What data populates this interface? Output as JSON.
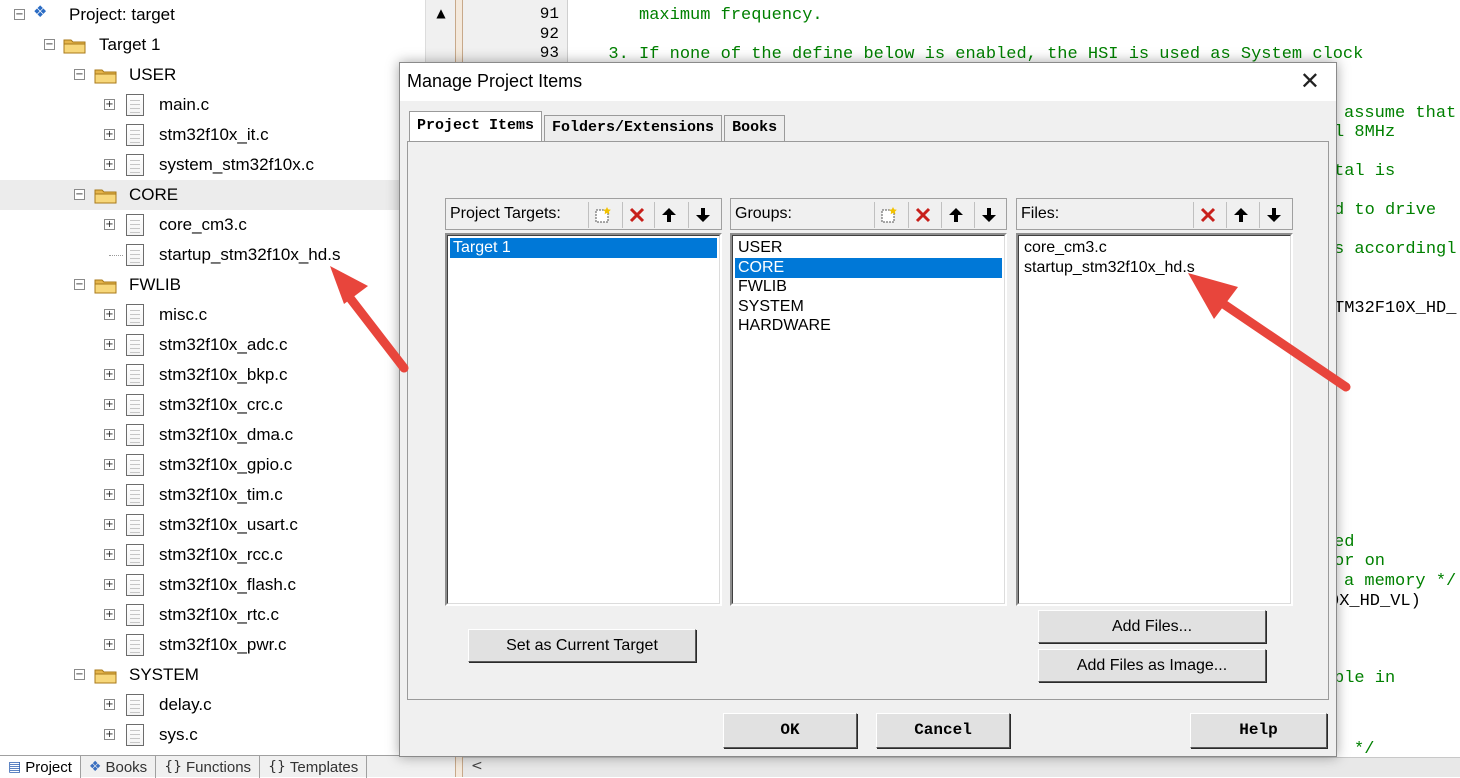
{
  "tree": {
    "project_label": "Project: target",
    "target_label": "Target 1",
    "groups": [
      {
        "name": "USER",
        "files": [
          "main.c",
          "stm32f10x_it.c",
          "system_stm32f10x.c"
        ]
      },
      {
        "name": "CORE",
        "files": [
          "core_cm3.c",
          "startup_stm32f10x_hd.s"
        ]
      },
      {
        "name": "FWLIB",
        "files": [
          "misc.c",
          "stm32f10x_adc.c",
          "stm32f10x_bkp.c",
          "stm32f10x_crc.c",
          "stm32f10x_dma.c",
          "stm32f10x_gpio.c",
          "stm32f10x_tim.c",
          "stm32f10x_usart.c",
          "stm32f10x_rcc.c",
          "stm32f10x_flash.c",
          "stm32f10x_rtc.c",
          "stm32f10x_pwr.c"
        ]
      },
      {
        "name": "SYSTEM",
        "files": [
          "delay.c",
          "sys.c"
        ]
      }
    ],
    "selected_group": "CORE"
  },
  "bottom_tabs": [
    {
      "label": "Project",
      "icon": "project-icon"
    },
    {
      "label": "Books",
      "icon": "books-icon"
    },
    {
      "label": "Functions",
      "icon": "functions-icon"
    },
    {
      "label": "Templates",
      "icon": "templates-icon"
    }
  ],
  "editor": {
    "lines": [
      {
        "num": "91",
        "text": "     maximum frequency."
      },
      {
        "num": "92",
        "text": ""
      },
      {
        "num": "93",
        "text": "  3. If none of the define below is enabled, the HSI is used as System clock"
      }
    ],
    "visible_fragments": [
      "assume that",
      "l 8MHz",
      "tal is",
      "d to drive",
      "s accordingl",
      "TM32F10X_HD_",
      "ed",
      "or on",
      "a memory */",
      "0X_HD_VL)",
      "ble in",
      "*/"
    ]
  },
  "dialog": {
    "title": "Manage Project Items",
    "tabs": [
      "Project Items",
      "Folders/Extensions",
      "Books"
    ],
    "active_tab": "Project Items",
    "targets": {
      "header": "Project Targets:",
      "items": [
        "Target 1"
      ],
      "selected": "Target 1"
    },
    "groups": {
      "header": "Groups:",
      "items": [
        "USER",
        "CORE",
        "FWLIB",
        "SYSTEM",
        "HARDWARE"
      ],
      "selected": "CORE"
    },
    "files": {
      "header": "Files:",
      "items": [
        "core_cm3.c",
        "startup_stm32f10x_hd.s"
      ]
    },
    "buttons": {
      "set_current": "Set as Current Target",
      "add_files": "Add Files...",
      "add_files_image": "Add Files as Image...",
      "ok": "OK",
      "cancel": "Cancel",
      "help": "Help"
    }
  },
  "colors": {
    "selection": "#0078d7",
    "comment_green": "#008000",
    "annotation_arrow": "#e8453c"
  }
}
